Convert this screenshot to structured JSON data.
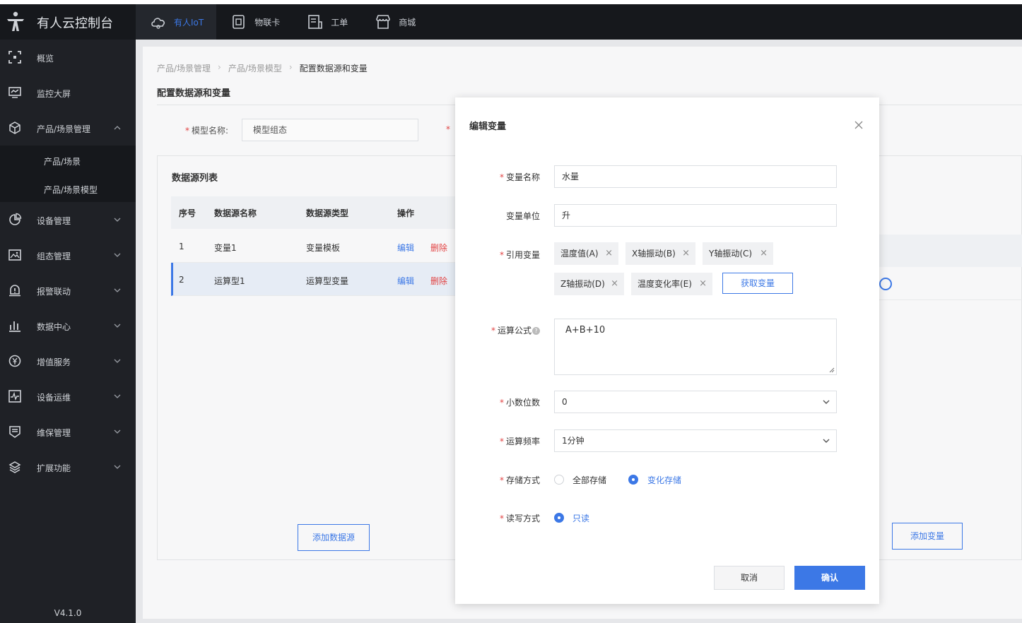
{
  "brand": {
    "name": "有人云控制台"
  },
  "topnav": [
    {
      "label": "有人IoT",
      "icon": "cloud-icon",
      "active": true
    },
    {
      "label": "物联卡",
      "icon": "sim-card-icon",
      "active": false
    },
    {
      "label": "工单",
      "icon": "ticket-icon",
      "active": false
    },
    {
      "label": "商城",
      "icon": "store-icon",
      "active": false
    }
  ],
  "sidebar": {
    "items": [
      {
        "label": "概览",
        "icon": "overview-icon"
      },
      {
        "label": "监控大屏",
        "icon": "monitor-icon"
      },
      {
        "label": "产品/场景管理",
        "icon": "cube-icon",
        "expanded": true
      },
      {
        "label": "设备管理",
        "icon": "pie-chart-icon"
      },
      {
        "label": "组态管理",
        "icon": "image-icon"
      },
      {
        "label": "报警联动",
        "icon": "alarm-icon"
      },
      {
        "label": "数据中心",
        "icon": "bar-chart-icon"
      },
      {
        "label": "增值服务",
        "icon": "yen-icon"
      },
      {
        "label": "设备运维",
        "icon": "pulse-icon"
      },
      {
        "label": "维保管理",
        "icon": "maintenance-icon"
      },
      {
        "label": "扩展功能",
        "icon": "layers-icon"
      }
    ],
    "sub_items": [
      "产品/场景",
      "产品/场景模型"
    ],
    "version": "V4.1.0"
  },
  "breadcrumb": [
    "产品/场景管理",
    "产品/场景模型",
    "配置数据源和变量"
  ],
  "page_title": "配置数据源和变量",
  "model": {
    "label": "模型名称:",
    "value": "模型组态",
    "label2_fragment": "*"
  },
  "datasource": {
    "title": "数据源列表",
    "columns": [
      "序号",
      "数据源名称",
      "数据源类型",
      "操作"
    ],
    "rows": [
      {
        "no": "1",
        "name": "变量1",
        "type": "变量模板",
        "edit": "编辑",
        "delete": "删除",
        "selected": false
      },
      {
        "no": "2",
        "name": "运算型1",
        "type": "运算型变量",
        "edit": "编辑",
        "delete": "删除",
        "selected": true
      }
    ],
    "add_button": "添加数据源",
    "add_variable_button": "添加变量"
  },
  "modal": {
    "title": "编辑变量",
    "fields": {
      "name": {
        "label": "变量名称",
        "value": "水量"
      },
      "unit": {
        "label": "变量单位",
        "value": "升"
      },
      "ref": {
        "label": "引用变量",
        "tags": [
          "温度值(A)",
          "X轴振动(B)",
          "Y轴振动(C)",
          "Z轴振动(D)",
          "温度变化率(E)"
        ],
        "fetch_button": "获取变量"
      },
      "formula": {
        "label": "运算公式",
        "value": "A+B+10"
      },
      "decimals": {
        "label": "小数位数",
        "value": "0"
      },
      "frequency": {
        "label": "运算频率",
        "value": "1分钟"
      },
      "storage": {
        "label": "存储方式",
        "options": [
          "全部存储",
          "变化存储"
        ],
        "selected": "变化存储"
      },
      "rw": {
        "label": "读写方式",
        "options": [
          "只读"
        ],
        "selected": "只读"
      }
    },
    "cancel": "取消",
    "confirm": "确认"
  },
  "colors": {
    "accent": "#3c78e6",
    "danger": "#e24444",
    "sidebar_bg": "#1f2126",
    "topbar_bg": "#16181c"
  }
}
